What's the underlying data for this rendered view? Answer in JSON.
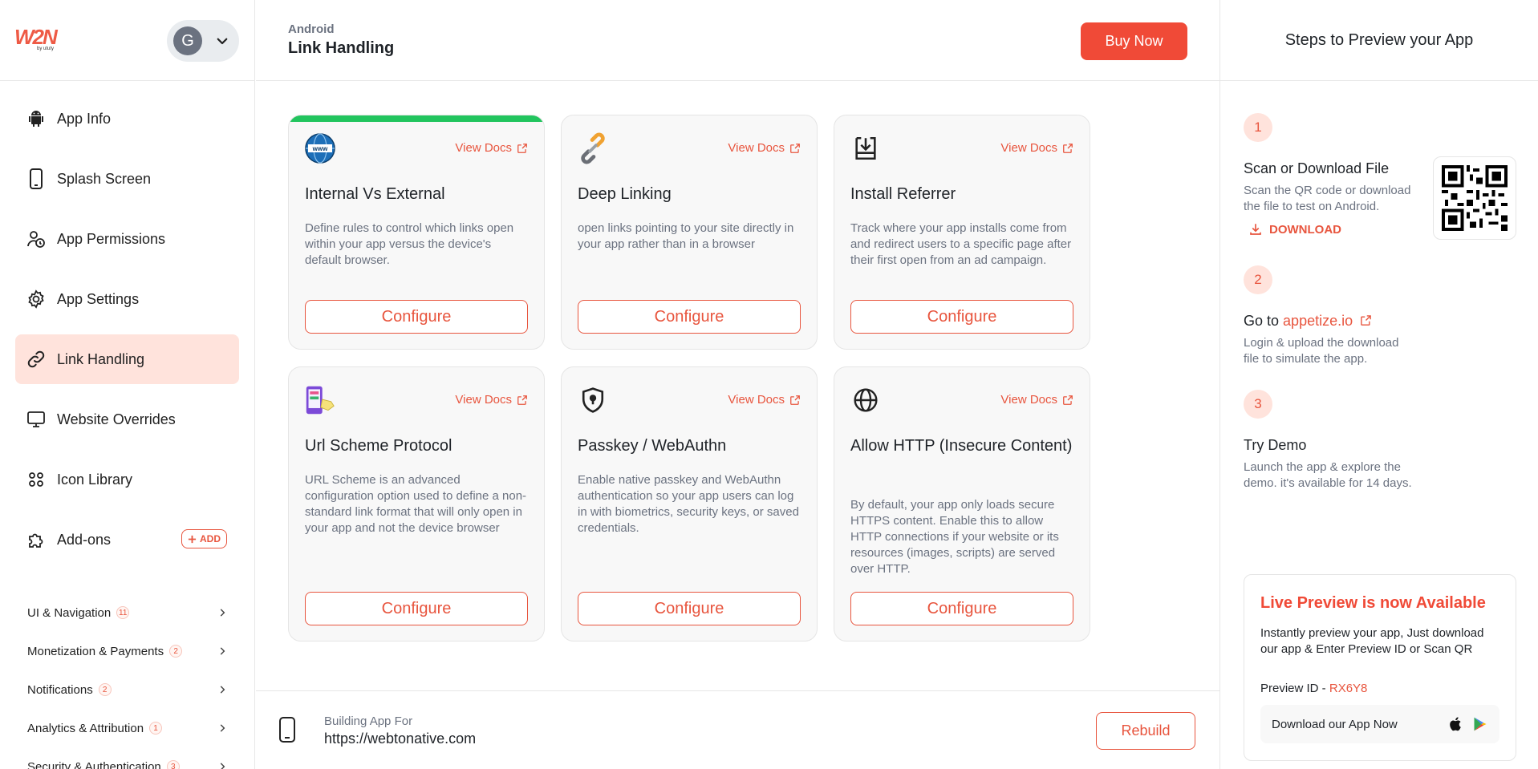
{
  "brand": {
    "logo_text": "W2N",
    "logo_sub": "by ututy",
    "brand_color": "#e8553e"
  },
  "account": {
    "initial": "G"
  },
  "sidebar": {
    "items": [
      {
        "label": "App Info",
        "icon": "android-icon"
      },
      {
        "label": "Splash Screen",
        "icon": "phone-icon"
      },
      {
        "label": "App Permissions",
        "icon": "user-clock-icon"
      },
      {
        "label": "App Settings",
        "icon": "gear-icon"
      },
      {
        "label": "Link Handling",
        "icon": "link-icon",
        "active": true
      },
      {
        "label": "Website Overrides",
        "icon": "monitor-icon"
      },
      {
        "label": "Icon Library",
        "icon": "grid-icon"
      },
      {
        "label": "Add-ons",
        "icon": "puzzle-icon"
      }
    ],
    "add_label": "ADD",
    "groups": [
      {
        "label": "UI & Navigation",
        "count": "11"
      },
      {
        "label": "Monetization & Payments",
        "count": "2"
      },
      {
        "label": "Notifications",
        "count": "2"
      },
      {
        "label": "Analytics & Attribution",
        "count": "1"
      },
      {
        "label": "Security & Authentication",
        "count": "3"
      }
    ]
  },
  "header": {
    "platform": "Android",
    "title": "Link Handling",
    "buy_label": "Buy Now"
  },
  "cards": [
    {
      "title": "Internal Vs External",
      "desc": "Define rules to control which links open within your app versus the device's default browser.",
      "docs": "View Docs",
      "configure": "Configure",
      "icon": "www-globe-icon"
    },
    {
      "title": "Deep Linking",
      "desc": "open links pointing to your site directly in your app rather than in a browser",
      "docs": "View Docs",
      "configure": "Configure",
      "icon": "chain-link-icon"
    },
    {
      "title": "Install Referrer",
      "desc": "Track where your app installs come from and redirect users to a specific page after their first open from an ad campaign.",
      "docs": "View Docs",
      "configure": "Configure",
      "icon": "download-tray-icon"
    },
    {
      "title": "Url Scheme Protocol",
      "desc": "URL Scheme is an advanced configuration option used to define a non-standard link format that will only open in your app and not the device browser",
      "docs": "View Docs",
      "configure": "Configure",
      "icon": "phone-scheme-icon"
    },
    {
      "title": "Passkey / WebAuthn",
      "desc": "Enable native passkey and WebAuthn authentication so your app users can log in with biometrics, security keys, or saved credentials.",
      "docs": "View Docs",
      "configure": "Configure",
      "icon": "shield-lock-icon"
    },
    {
      "title": "Allow HTTP (Insecure Content)",
      "desc": "By default, your app only loads secure HTTPS content. Enable this to allow HTTP connections if your website or its resources (images, scripts) are served over HTTP.",
      "docs": "View Docs",
      "configure": "Configure",
      "icon": "globe-icon"
    }
  ],
  "footer": {
    "label": "Building App For",
    "url": "https://webtonative.com",
    "rebuild_label": "Rebuild"
  },
  "preview": {
    "title": "Steps to Preview your App",
    "steps": [
      {
        "num": "1",
        "title": "Scan or Download File",
        "desc": "Scan the QR code or download the file to test on Android.",
        "action": "DOWNLOAD"
      },
      {
        "num": "2",
        "title_prefix": "Go to",
        "link": "appetize.io",
        "desc": "Login & upload the download file to simulate the app."
      },
      {
        "num": "3",
        "title": "Try Demo",
        "desc": "Launch the app & explore the demo. it's available for 14 days."
      }
    ],
    "live": {
      "title": "Live Preview is now Available",
      "desc": "Instantly preview your app, Just download our app & Enter Preview ID or Scan QR",
      "pid_label": "Preview ID - ",
      "pid_value": "RX6Y8",
      "download_label": "Download our App Now"
    }
  }
}
